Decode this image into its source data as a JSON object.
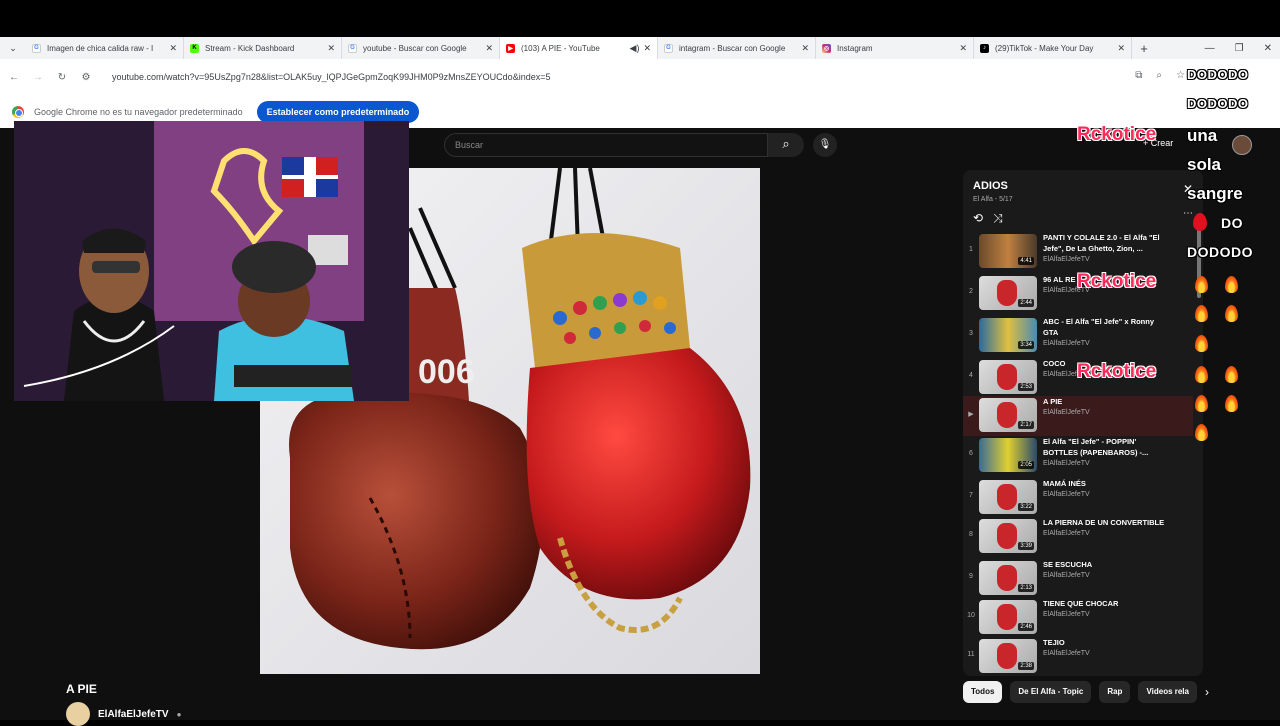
{
  "browser": {
    "tabs": [
      {
        "title": "Imagen de chica calida raw - I",
        "icon": "google-icon",
        "icon_color": "#ffffff"
      },
      {
        "title": "Stream - Kick Dashboard",
        "icon": "kick-icon",
        "icon_color": "#53fc18"
      },
      {
        "title": "youtube - Buscar con Google",
        "icon": "google-icon",
        "icon_color": "#ffffff"
      },
      {
        "title": "(103) A PIE - YouTube",
        "icon": "youtube-icon",
        "icon_color": "#ff0000"
      },
      {
        "title": "intagram - Buscar con Google",
        "icon": "google-icon",
        "icon_color": "#ffffff"
      },
      {
        "title": "Instagram",
        "icon": "instagram-icon",
        "icon_color": "#e1306c"
      },
      {
        "title": "(29)TikTok - Make Your Day",
        "icon": "tiktok-icon",
        "icon_color": "#000000"
      }
    ],
    "url": "youtube.com/watch?v=95UsZpg7n28&list=OLAK5uy_lQPJGeGpmZoqK99JHM0P9zMnsZEYOUCdo&index=5",
    "infobar_text": "Google Chrome no es tu navegador predeterminado",
    "infobar_button": "Establecer como predeterminado"
  },
  "youtube": {
    "search_placeholder": "Buscar",
    "create_label": "Crear",
    "video_title": "A PIE",
    "channel_name": "ElAlfaElJefeTV",
    "playlist": {
      "title": "ADIOS",
      "subtitle": "El Alfa - 5/17",
      "items": [
        {
          "num": "1",
          "title": "PANTI Y COLALE 2.0 - El Alfa \"El Jefe\", De La Ghetto, Zion, ...",
          "channel": "ElAlfaElJefeTV",
          "duration": "4:41"
        },
        {
          "num": "2",
          "title": "96 AL RE",
          "channel": "ElAlfaElJefeTV",
          "duration": "2:44"
        },
        {
          "num": "3",
          "title": "ABC - El Alfa \"El Jefe\" x Ronny GTA",
          "channel": "ElAlfaElJefeTV",
          "duration": "3:34"
        },
        {
          "num": "4",
          "title": "COCO",
          "channel": "ElAlfaElJef",
          "duration": "2:53"
        },
        {
          "num": "▶",
          "title": "A PIE",
          "channel": "ElAlfaElJefeTV",
          "duration": "2:17"
        },
        {
          "num": "6",
          "title": "El Alfa \"El Jefe\" - POPPIN' BOTTLES (PAPENBAROS) -...",
          "channel": "ElAlfaElJefeTV",
          "duration": "2:05"
        },
        {
          "num": "7",
          "title": "MAMÁ INÉS",
          "channel": "ElAlfaElJefeTV",
          "duration": "3:22"
        },
        {
          "num": "8",
          "title": "LA PIERNA DE UN CONVERTIBLE",
          "channel": "ElAlfaElJefeTV",
          "duration": "3:39"
        },
        {
          "num": "9",
          "title": "SE ESCUCHA",
          "channel": "ElAlfaElJefeTV",
          "duration": "2:13"
        },
        {
          "num": "10",
          "title": "TIENE QUE CHOCAR",
          "channel": "ElAlfaElJefeTV",
          "duration": "2:46"
        },
        {
          "num": "11",
          "title": "TEJIO",
          "channel": "ElAlfaElJefeTV",
          "duration": "2:38"
        }
      ]
    },
    "chips": [
      "Todos",
      "De El Alfa - Topic",
      "Rap",
      "Videos rela"
    ]
  },
  "overlay": {
    "dododo_1": "DODODO",
    "dododo_2": "DODODO",
    "rk_1": "Rckotice",
    "rk_2": "Rckotice",
    "rk_3": "Rckotice",
    "w_una": "una",
    "w_sola": "sola",
    "w_sangre": "sangre",
    "w_do": "DO",
    "w_dododo3": "DODODO"
  },
  "colors": {
    "accent": "#0b57d0",
    "youtube_red": "#ff0000",
    "rk_pink": "#ff2a5a"
  }
}
